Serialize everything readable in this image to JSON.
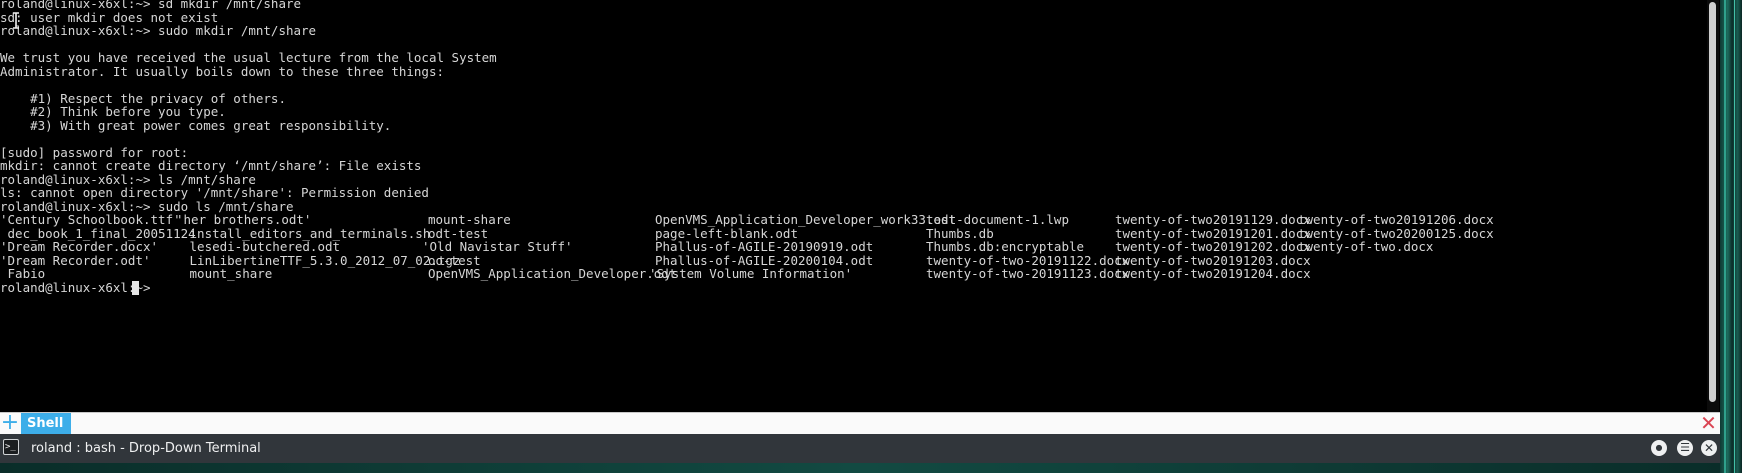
{
  "terminal": {
    "lines": [
      {
        "segments": [
          "roland@linux-x6xl:~> sd mkdir /mnt/share"
        ]
      },
      {
        "segments": [
          "sd: user mkdir does not exist"
        ]
      },
      {
        "segments": [
          "roland@linux-x6xl:~> sudo mkdir /mnt/share"
        ]
      },
      {
        "segments": [
          ""
        ]
      },
      {
        "segments": [
          "We trust you have received the usual lecture from the local System"
        ]
      },
      {
        "segments": [
          "Administrator. It usually boils down to these three things:"
        ]
      },
      {
        "segments": [
          ""
        ]
      },
      {
        "segments": [
          "    #1) Respect the privacy of others."
        ]
      },
      {
        "segments": [
          "    #2) Think before you type."
        ]
      },
      {
        "segments": [
          "    #3) With great power comes great responsibility."
        ]
      },
      {
        "segments": [
          ""
        ]
      },
      {
        "segments": [
          "[sudo] password for root:"
        ]
      },
      {
        "segments": [
          "mkdir: cannot create directory ‘/mnt/share’: File exists"
        ]
      },
      {
        "segments": [
          "roland@linux-x6xl:~> ls /mnt/share"
        ]
      },
      {
        "segments": [
          "ls: cannot open directory '/mnt/share': Permission denied"
        ]
      },
      {
        "segments": [
          "roland@linux-x6xl:~> sudo ls /mnt/share"
        ]
      },
      {
        "segments": [
          "'Century Schoolbook.ttf'",
          "'her brothers.odt'",
          "mount-share",
          "OpenVMS_Application_Developer_work33.odt",
          "test-document-1.lwp",
          "twenty-of-two20191129.docx",
          "twenty-of-two20191206.docx"
        ]
      },
      {
        "segments": [
          " dec_book_1_final_20051124",
          " install_editors_and_terminals.sh",
          "odt-test",
          "page-left-blank.odt",
          "Thumbs.db",
          "twenty-of-two20191201.docx",
          "twenty-of-two20200125.docx"
        ]
      },
      {
        "segments": [
          "'Dream Recorder.docx'",
          " lesedi-butchered.odt",
          "'Old Navistar Stuff'",
          "Phallus-of-AGILE-20190919.odt",
          "Thumbs.db:encryptable",
          "twenty-of-two20191202.docx",
          "twenty-of-two.docx"
        ]
      },
      {
        "segments": [
          "'Dream Recorder.odt'",
          " LinLibertineTTF_5.3.0_2012_07_02.tgz",
          "oo-test",
          "Phallus-of-AGILE-20200104.odt",
          "twenty-of-two-20191122.docx",
          "twenty-of-two20191203.docx"
        ]
      },
      {
        "segments": [
          " Fabio",
          " mount_share",
          "OpenVMS_Application_Developer.odt",
          "'System Volume Information'",
          "twenty-of-two-20191123.docx",
          "twenty-of-two20191204.docx"
        ]
      },
      {
        "segments": [
          "roland@linux-x6xl:~> "
        ]
      }
    ]
  },
  "tabbar": {
    "new_tab_icon": "+",
    "active_tab": "Shell",
    "close_icon": "✕"
  },
  "titlebar": {
    "icon_glyph": ">_",
    "title": "roland : bash - Drop-Down Terminal",
    "keep_above_glyph": "●",
    "menu_glyph": "☰",
    "close_glyph": "✕"
  },
  "colors": {
    "terminal_background": "#000000",
    "terminal_foreground": "#d6d6d6",
    "accent": "#3daee9",
    "titlebar": "#31363b",
    "close_red": "#da4453"
  }
}
